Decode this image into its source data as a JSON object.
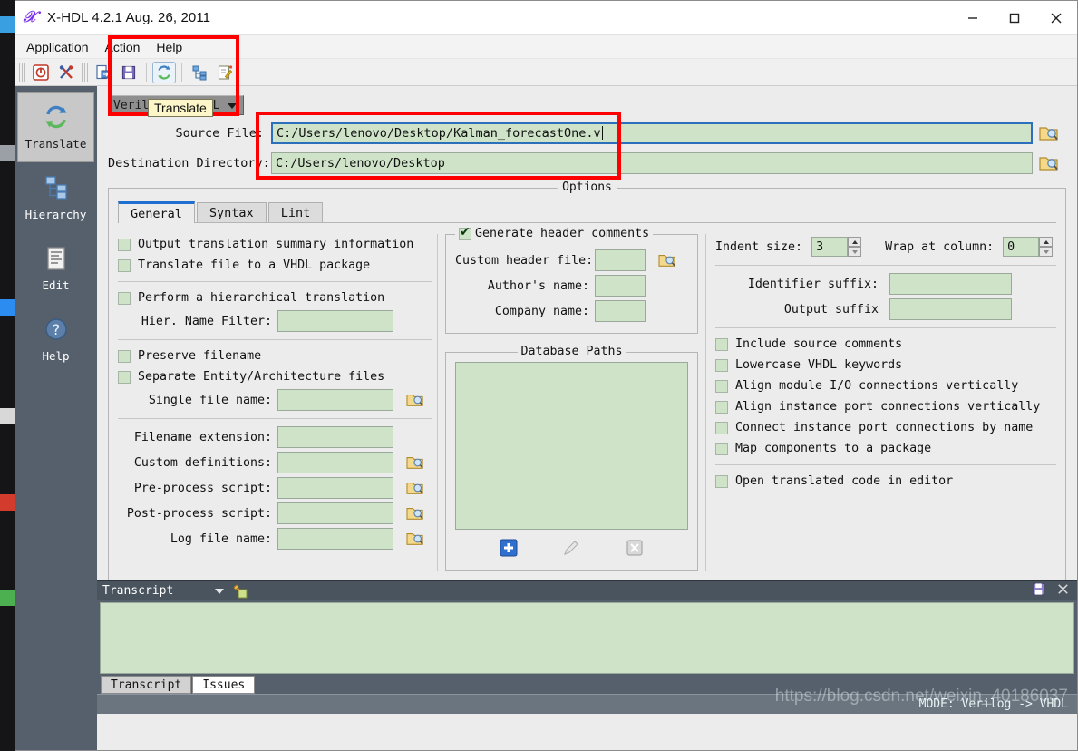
{
  "window": {
    "title": "X-HDL 4.2.1  Aug. 26, 2011",
    "app_icon": "x-hdl-logo-icon",
    "minimize": "minimize-icon",
    "maximize": "maximize-icon",
    "close": "close-icon"
  },
  "menubar": {
    "items": [
      {
        "label": "Application"
      },
      {
        "label": "Action"
      },
      {
        "label": "Help"
      }
    ]
  },
  "toolbar": {
    "buttons": [
      {
        "name": "exit-icon"
      },
      {
        "name": "preferences-tools-icon"
      },
      {
        "name": "open-file-icon"
      },
      {
        "name": "save-file-icon"
      },
      {
        "name": "translate-icon"
      },
      {
        "name": "hierarchy-icon"
      },
      {
        "name": "edit-icon"
      }
    ]
  },
  "sidebar": {
    "items": [
      {
        "label": "Translate",
        "icon": "translate-refresh-icon",
        "selected": true
      },
      {
        "label": "Hierarchy",
        "icon": "hierarchy-tree-icon",
        "selected": false
      },
      {
        "label": "Edit",
        "icon": "document-edit-icon",
        "selected": false
      },
      {
        "label": "Help",
        "icon": "help-question-icon",
        "selected": false
      }
    ]
  },
  "form": {
    "mode_combo": {
      "value": "Verilog -> VHDL",
      "arrow_icon": "chevron-down-icon"
    },
    "source_file": {
      "label": "Source File:",
      "value": "C:/Users/lenovo/Desktop/Kalman_forecastOne.v",
      "browse_icon": "folder-search-icon"
    },
    "destination_directory": {
      "label": "Destination Directory:",
      "value": "C:/Users/lenovo/Desktop",
      "browse_icon": "folder-search-icon"
    }
  },
  "tooltip": {
    "text": "Translate"
  },
  "options": {
    "legend": "Options",
    "tabs": [
      {
        "label": "General",
        "active": true
      },
      {
        "label": "Syntax",
        "active": false
      },
      {
        "label": "Lint",
        "active": false
      }
    ],
    "general": {
      "left_column": {
        "checkboxes_top": [
          {
            "label": "Output translation summary information",
            "checked": false
          },
          {
            "label": "Translate file to a VHDL package",
            "checked": false
          }
        ],
        "hierarchical": {
          "label": "Perform a hierarchical translation",
          "checked": false
        },
        "hier_name_filter": {
          "label": "Hier. Name Filter:",
          "value": ""
        },
        "checkboxes_mid": [
          {
            "label": "Preserve filename",
            "checked": false
          },
          {
            "label": "Separate Entity/Architecture files",
            "checked": false
          }
        ],
        "single_file_name": {
          "label": "Single file name:",
          "value": "",
          "browse_icon": "folder-search-icon"
        },
        "fields": [
          {
            "label": "Filename extension:",
            "value": "",
            "browse": false
          },
          {
            "label": "Custom definitions:",
            "value": "",
            "browse": true
          },
          {
            "label": "Pre-process script:",
            "value": "",
            "browse": true
          },
          {
            "label": "Post-process script:",
            "value": "",
            "browse": true
          },
          {
            "label": "Log file name:",
            "value": "",
            "browse": true
          }
        ]
      },
      "middle_column": {
        "header_group": {
          "legend": "Generate header comments",
          "checked": true,
          "fields": [
            {
              "label": "Custom header file:",
              "value": "",
              "browse": true
            },
            {
              "label": "Author's name:",
              "value": "",
              "browse": false
            },
            {
              "label": "Company name:",
              "value": "",
              "browse": false
            }
          ]
        },
        "database_group": {
          "legend": "Database Paths",
          "items": [],
          "tools": [
            {
              "name": "add-path-icon"
            },
            {
              "name": "edit-path-icon"
            },
            {
              "name": "delete-path-icon"
            }
          ]
        }
      },
      "right_column": {
        "indent_size": {
          "label": "Indent size:",
          "value": "3"
        },
        "wrap_at_column": {
          "label": "Wrap at column:",
          "value": "0"
        },
        "identifier_suffix": {
          "label": "Identifier suffix:",
          "value": ""
        },
        "output_suffix": {
          "label": "Output suffix",
          "value": ""
        },
        "checkboxes": [
          {
            "label": "Include source comments",
            "checked": false
          },
          {
            "label": "Lowercase VHDL keywords",
            "checked": false
          },
          {
            "label": "Align module I/O connections vertically",
            "checked": false
          },
          {
            "label": "Align instance port connections vertically",
            "checked": false
          },
          {
            "label": "Connect instance port connections by name",
            "checked": false
          },
          {
            "label": "Map components to a package",
            "checked": false
          }
        ],
        "open_in_editor": {
          "label": "Open translated code in editor",
          "checked": false
        }
      }
    }
  },
  "transcript": {
    "title": "Transcript",
    "arrow_icon": "chevron-down-icon",
    "clear_icon": "clear-broom-icon",
    "save_icon": "save-floppy-icon",
    "close_icon": "close-icon",
    "content": "",
    "tabs": [
      {
        "label": "Transcript",
        "active": false
      },
      {
        "label": "Issues",
        "active": true
      }
    ]
  },
  "statusbar": {
    "mode": "MODE: Verilog -> VHDL",
    "watermark": "https://blog.csdn.net/weixin_40186037"
  }
}
